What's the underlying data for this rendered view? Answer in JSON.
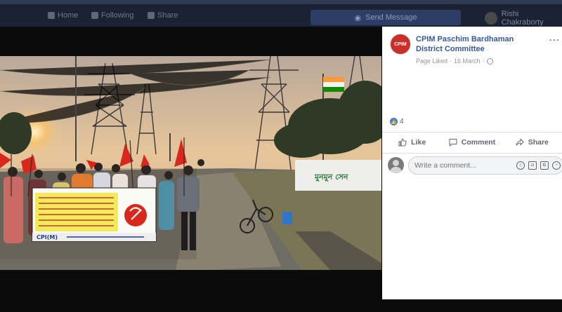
{
  "topbar": {
    "nav_items": [
      "Home",
      "Following",
      "Share"
    ],
    "send_message": "Send Message",
    "user_name": "Rishi Chakraborty"
  },
  "post": {
    "page_name": "CPIM Paschim Bardhaman District Committee",
    "avatar_text": "CPIM",
    "status": "Page Liked",
    "date": "16 March",
    "separator": "·",
    "more": "···",
    "like_count": "4",
    "actions": {
      "like": "Like",
      "comment": "Comment",
      "share": "Share"
    },
    "comment_placeholder": "Write a comment...",
    "comment_tools": [
      "emoji-icon",
      "camera-icon",
      "gif-icon",
      "sticker-icon"
    ]
  },
  "photo": {
    "alt": "",
    "banner_party": "CPI(M)",
    "wall_text": "মুনমুন সেন"
  },
  "colors": {
    "link": "#365899",
    "meta": "#90949c",
    "action": "#606770",
    "like_blue": "#3b7bf0",
    "topbar": "#1b2233"
  }
}
